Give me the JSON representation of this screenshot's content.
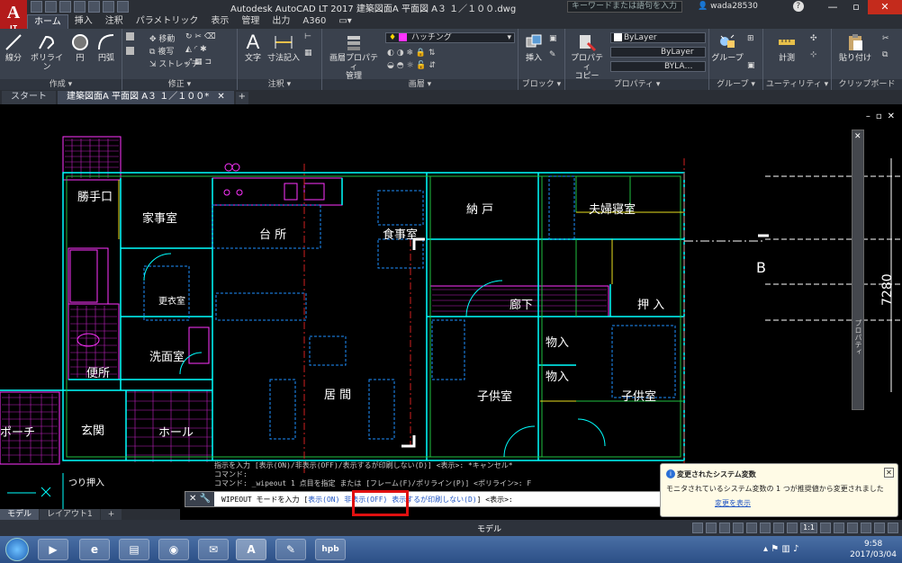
{
  "titlebar": {
    "logo": "A",
    "logo_sub": "LT",
    "title": "Autodesk AutoCAD LT 2017    建築図面A   平面図   A３   １／１００.dwg",
    "search_placeholder": "キーワードまたは語句を入力",
    "user": "wada28530",
    "help_icon": "?",
    "controls": [
      "—",
      "▫",
      "✕"
    ]
  },
  "ribbon_tabs": [
    "ホーム",
    "挿入",
    "注釈",
    "パラメトリック",
    "表示",
    "管理",
    "出力",
    "A360",
    "▭▾"
  ],
  "ribbon": {
    "draw_panel": {
      "title": "作成 ▾",
      "line": "線分",
      "polyline": "ポリライン",
      "circle": "円",
      "arc": "円弧"
    },
    "modify_panel": {
      "title": "修正 ▾",
      "move": "移動",
      "copy": "複写",
      "stretch": "ストレッチ"
    },
    "annotation_panel": {
      "title": "注釈 ▾",
      "text": "文字",
      "dimension": "寸法記入"
    },
    "layer_panel": {
      "title": "画層 ▾",
      "layer_props_1": "画層プロパティ",
      "layer_props_2": "管理",
      "current_layer": "ハッチング"
    },
    "block_panel": {
      "title": "ブロック ▾",
      "insert": "挿入"
    },
    "properties_panel": {
      "title": "プロパティ ▾",
      "match_1": "プロパティ",
      "match_2": "コピー",
      "color": "ByLayer",
      "linetype": "ByLayer",
      "lineweight": "BYLA…"
    },
    "groups_panel": {
      "title": "グループ ▾",
      "group": "グループ"
    },
    "utilities_panel": {
      "title": "ユーティリティ ▾",
      "measure": "計測"
    },
    "clipboard_panel": {
      "title": "クリップボード",
      "paste": "貼り付け"
    }
  },
  "file_tabs": [
    "スタート",
    "建築図面A   平面図   A３   １／１００*"
  ],
  "drawing": {
    "rooms": [
      "勝手口",
      "家事室",
      "台 所",
      "食事室",
      "納 戸",
      "夫婦寝室",
      "更衣室",
      "洗面室",
      "便所",
      "居 間",
      "廊下",
      "押 入",
      "物入",
      "物入",
      "子供室",
      "子供室",
      "玄関",
      "ホール",
      "ポーチ",
      "つり押入"
    ],
    "section_mark": "B",
    "dimension": "7280",
    "palette_label": "プロパティ",
    "viewport_controls": [
      "–",
      "▫",
      "✕"
    ]
  },
  "command_history": [
    "指示を入力 [表示(ON)/非表示(OFF)/表示するが印刷しない(D)] <表示>: *キャンセル*",
    "コマンド:",
    "コマンド: _wipeout 1 点目を指定 または [フレーム(F)/ポリライン(P)] <ポリライン>: F"
  ],
  "command_line": {
    "prompt": "WIPEOUT モードを入力 [",
    "opt_on": "表示(ON)",
    "sep1": " ",
    "opt_off": "非表示(OFF)",
    "sep2": " ",
    "opt_d": "表示するが印刷しない(D)",
    "suffix": "] <表示>:"
  },
  "notification": {
    "title": "変更されたシステム変数",
    "body": "モニタされているシステム変数の 1 つが推奨値から変更されました",
    "link": "変更を表示"
  },
  "layout_tabs": [
    "モデル",
    "レイアウト1",
    "+"
  ],
  "statusbar": {
    "model_label": "モデル",
    "scale": "1:1"
  },
  "taskbar": {
    "apps": [
      "▶",
      "e",
      "▤",
      "◉",
      "✉",
      "A",
      "✎",
      "hpb"
    ],
    "time": "9:58",
    "date": "2017/03/04"
  },
  "colors": {
    "ribbon_bg": "#3a414d",
    "wall": "#00ffff",
    "furniture": "#ff33ff",
    "hidden": "#1e90ff",
    "accent_red": "#e01010"
  }
}
